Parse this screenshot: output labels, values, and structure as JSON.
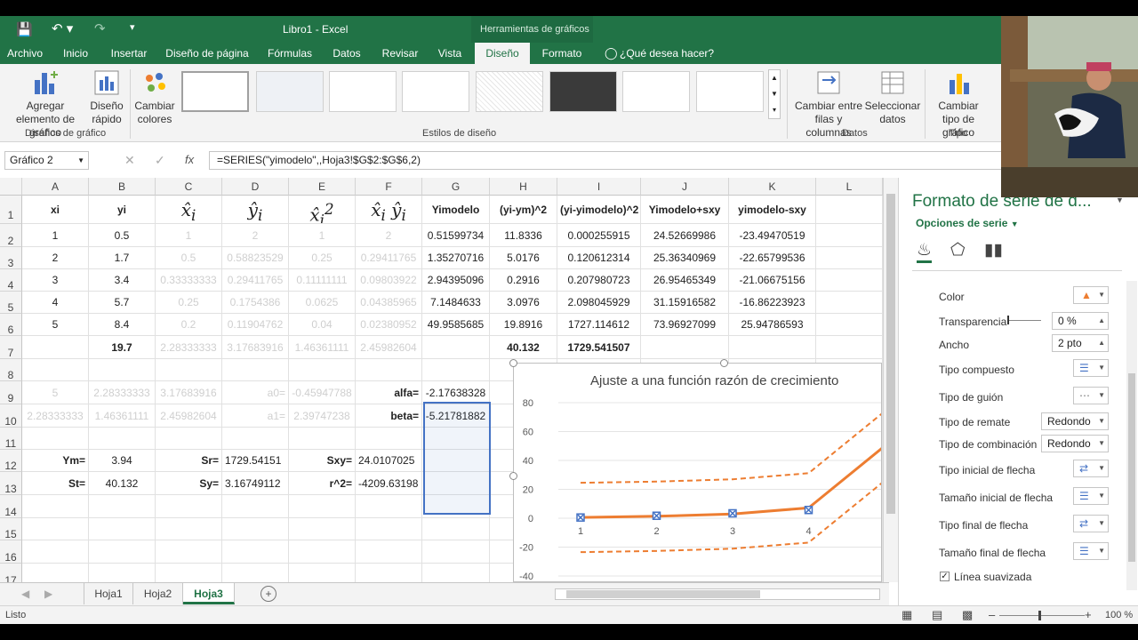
{
  "titlebar": {
    "title": "Libro1 - Excel",
    "context_title": "Herramientas de gráficos"
  },
  "tabs": [
    "Archivo",
    "Inicio",
    "Insertar",
    "Diseño de página",
    "Fórmulas",
    "Datos",
    "Revisar",
    "Vista",
    "Diseño",
    "Formato"
  ],
  "tellme": "¿Qué desea hacer?",
  "ribbon": {
    "add_element": "Agregar elemento de gráfico",
    "quick_layout": "Diseño rápido",
    "change_colors": "Cambiar colores",
    "switch_rowcol": "Cambiar entre filas y columnas",
    "select_data": "Seleccionar datos",
    "change_type": "Cambiar tipo de gráfico",
    "group_layouts": "Diseños de gráfico",
    "group_styles": "Estilos de diseño",
    "group_data": "Datos",
    "group_type": "Tipo"
  },
  "namebox": "Gráfico 2",
  "formula": "=SERIES(\"yimodelo\",,Hoja3!$G$2:$G$6,2)",
  "columns": [
    "A",
    "B",
    "C",
    "D",
    "E",
    "F",
    "G",
    "H",
    "I",
    "J",
    "K",
    "L"
  ],
  "rows": [
    "1",
    "2",
    "3",
    "4",
    "5",
    "6",
    "7",
    "8",
    "9",
    "10",
    "11",
    "12",
    "13",
    "14",
    "15",
    "16",
    "17"
  ],
  "headers": {
    "a": "xi",
    "b": "yi",
    "g": "Yimodelo",
    "h": "(yi-ym)^2",
    "i": "(yi-yimodelo)^2",
    "j": "Yimodelo+sxy",
    "k": "yimodelo-sxy"
  },
  "data_rows": [
    {
      "a": "1",
      "b": "0.5",
      "c": "1",
      "d": "2",
      "e": "1",
      "f": "2",
      "g": "0.51599734",
      "h": "11.8336",
      "i": "0.000255915",
      "j": "24.52669986",
      "k": "-23.49470519"
    },
    {
      "a": "2",
      "b": "1.7",
      "c": "0.5",
      "d": "0.58823529",
      "e": "0.25",
      "f": "0.29411765",
      "g": "1.35270716",
      "h": "5.0176",
      "i": "0.120612314",
      "j": "25.36340969",
      "k": "-22.65799536"
    },
    {
      "a": "3",
      "b": "3.4",
      "c": "0.33333333",
      "d": "0.29411765",
      "e": "0.11111111",
      "f": "0.09803922",
      "g": "2.94395096",
      "h": "0.2916",
      "i": "0.207980723",
      "j": "26.95465349",
      "k": "-21.06675156"
    },
    {
      "a": "4",
      "b": "5.7",
      "c": "0.25",
      "d": "0.1754386",
      "e": "0.0625",
      "f": "0.04385965",
      "g": "7.1484633",
      "h": "3.0976",
      "i": "2.098045929",
      "j": "31.15916582",
      "k": "-16.86223923"
    },
    {
      "a": "5",
      "b": "8.4",
      "c": "0.2",
      "d": "0.11904762",
      "e": "0.04",
      "f": "0.02380952",
      "g": "49.9585685",
      "h": "19.8916",
      "i": "1727.114612",
      "j": "73.96927099",
      "k": "25.94786593"
    }
  ],
  "row7": {
    "b": "19.7",
    "c": "2.28333333",
    "d": "3.17683916",
    "e": "1.46361111",
    "f": "2.45982604",
    "h": "40.132",
    "i": "1729.541507"
  },
  "row9": {
    "a": "5",
    "b": "2.28333333",
    "c": "3.17683916",
    "d": "a0=",
    "e": "-0.45947788",
    "f": "alfa=",
    "g": "-2.17638328"
  },
  "row10": {
    "a": "2.28333333",
    "b": "1.46361111",
    "c": "2.45982604",
    "d": "a1=",
    "e": "2.39747238",
    "f": "beta=",
    "g": "-5.21781882"
  },
  "row12": {
    "a": "Ym=",
    "b": "3.94",
    "c": "Sr=",
    "d": "1729.54151",
    "e": "Sxy=",
    "f": "24.0107025"
  },
  "row13": {
    "a": "St=",
    "b": "40.132",
    "c": "Sy=",
    "d": "3.16749112",
    "e": "r^2=",
    "f": "-4209.63198"
  },
  "chart_data": {
    "type": "line",
    "title": "Ajuste a una función razón de crecimiento",
    "categories": [
      "1",
      "2",
      "3",
      "4"
    ],
    "y_ticks": [
      "80",
      "60",
      "40",
      "20",
      "0",
      "-20",
      "-40"
    ],
    "ylim": [
      -40,
      80
    ],
    "series": [
      {
        "values": [
          0.52,
          1.35,
          2.94,
          7.15,
          49.96
        ]
      },
      {
        "values": [
          24.53,
          25.36,
          26.95,
          31.16,
          73.97
        ]
      },
      {
        "values": [
          -23.49,
          -22.66,
          -21.07,
          -16.86,
          25.95
        ]
      }
    ],
    "points": [
      0.5,
      1.7,
      3.4,
      5.7
    ],
    "colors": {
      "line": "#ed7d31",
      "marker": "#4472c4"
    }
  },
  "sheets": [
    "Hoja1",
    "Hoja2",
    "Hoja3"
  ],
  "status": {
    "mode": "Listo",
    "zoom": "100 %"
  },
  "pane": {
    "title": "Formato de serie de d...",
    "options": "Opciones de serie",
    "color": "Color",
    "transparency": "Transparencia",
    "transparency_val": "0 %",
    "width": "Ancho",
    "width_val": "2 pto",
    "compound": "Tipo compuesto",
    "dash": "Tipo de guión",
    "cap": "Tipo de remate",
    "cap_val": "Redondo",
    "join": "Tipo de combinación",
    "join_val": "Redondo",
    "begin_arrow": "Tipo inicial de flecha",
    "begin_size": "Tamaño inicial de flecha",
    "end_arrow": "Tipo final de flecha",
    "end_size": "Tamaño final de flecha",
    "smooth": "Línea suavizada"
  }
}
